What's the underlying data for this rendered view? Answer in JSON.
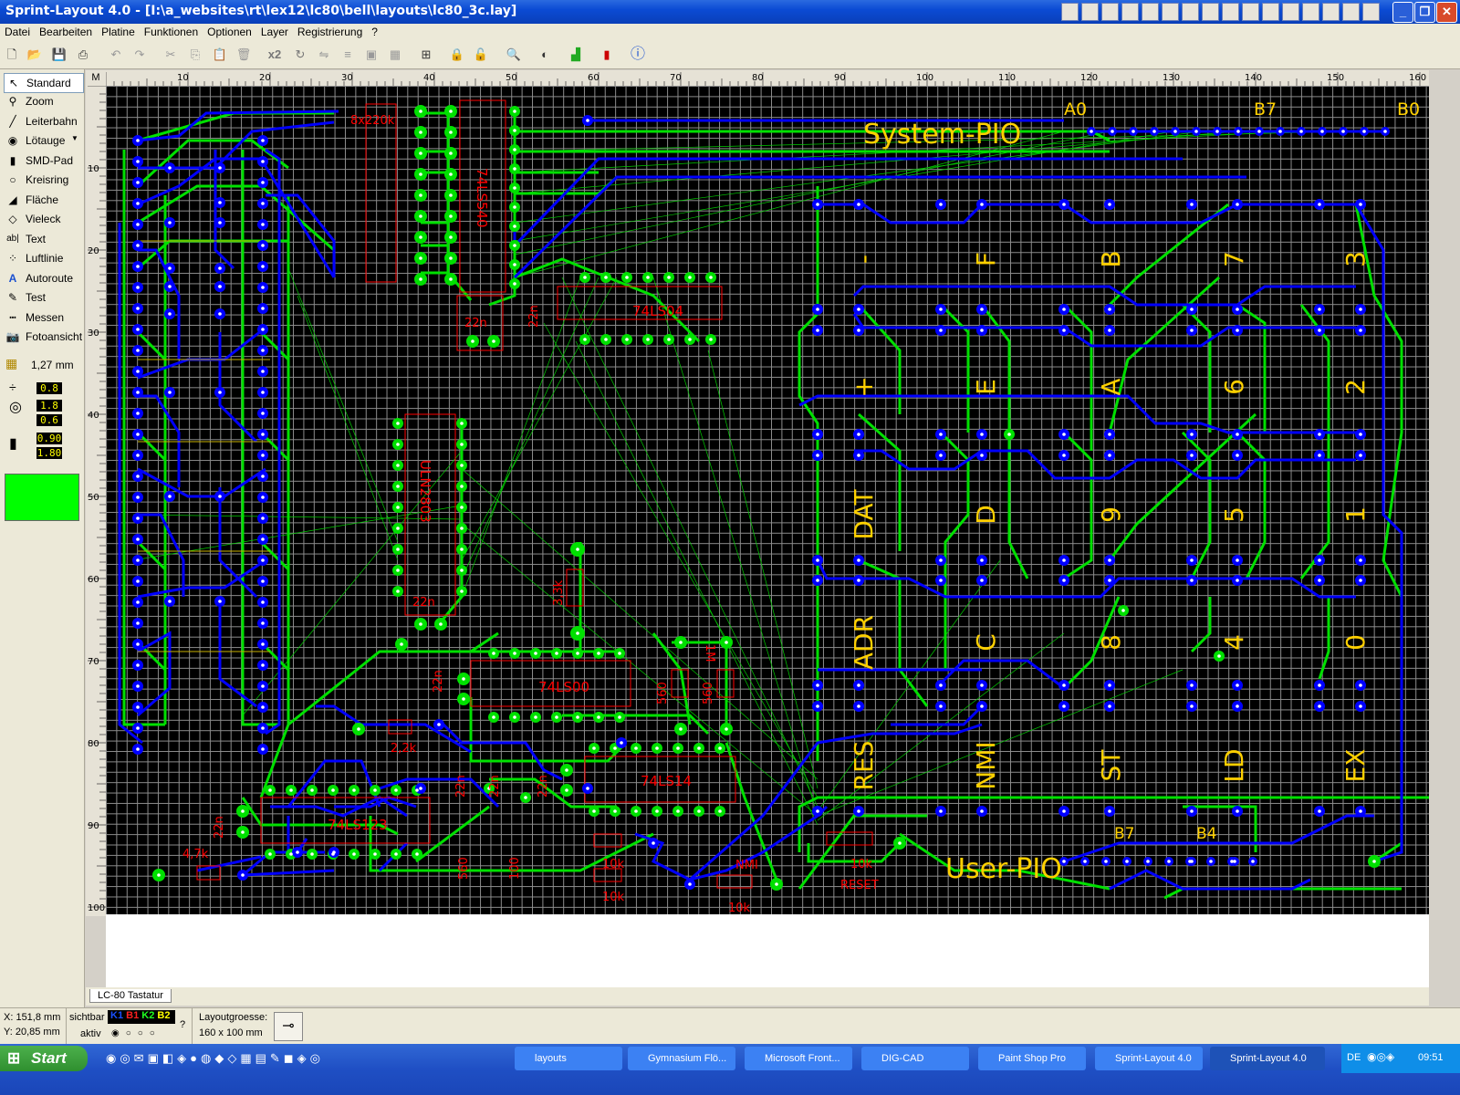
{
  "window": {
    "title": "Sprint-Layout 4.0 - [I:\\a_websites\\rt\\lex12\\lc80\\bell\\layouts\\lc80_3c.lay]"
  },
  "menu": [
    "Datei",
    "Bearbeiten",
    "Platine",
    "Funktionen",
    "Optionen",
    "Layer",
    "Registrierung",
    "?"
  ],
  "toolbar": {
    "mirror_label": "x2"
  },
  "tools": [
    {
      "label": "Standard",
      "icon": "arrow-icon"
    },
    {
      "label": "Zoom",
      "icon": "magnifier-icon"
    },
    {
      "label": "Leiterbahn",
      "icon": "track-icon"
    },
    {
      "label": "Lötauge",
      "icon": "pad-icon"
    },
    {
      "label": "SMD-Pad",
      "icon": "smd-icon"
    },
    {
      "label": "Kreisring",
      "icon": "ring-icon"
    },
    {
      "label": "Fläche",
      "icon": "area-icon"
    },
    {
      "label": "Vieleck",
      "icon": "polygon-icon"
    },
    {
      "label": "Text",
      "icon": "text-icon"
    },
    {
      "label": "Luftlinie",
      "icon": "airwire-icon"
    },
    {
      "label": "Autoroute",
      "icon": "autoroute-icon"
    },
    {
      "label": "Test",
      "icon": "test-icon"
    },
    {
      "label": "Messen",
      "icon": "measure-icon"
    },
    {
      "label": "Fotoansicht",
      "icon": "camera-icon"
    }
  ],
  "settings": {
    "grid": "1,27 mm",
    "v1": "0.8",
    "v2": "1.8",
    "v3": "0.6",
    "v4": "0.90",
    "v5": "1.80"
  },
  "ruler": {
    "corner": "M",
    "top_labels": [
      "10",
      "20",
      "30",
      "40",
      "50",
      "60",
      "70",
      "80",
      "90",
      "100",
      "110",
      "120",
      "130",
      "140",
      "150",
      "160"
    ],
    "left_labels": [
      "10",
      "20",
      "30",
      "40",
      "50",
      "60",
      "70",
      "80",
      "90",
      "100"
    ]
  },
  "board_labels": {
    "system_pio": "System-PIO",
    "user_pio": "User-PIO",
    "a0": "A0",
    "b7_top": "B7",
    "b0": "B0",
    "b7_bottom": "B7",
    "b4": "B4",
    "keys_row1": [
      "-",
      "F",
      "B",
      "7",
      "3"
    ],
    "keys_row2": [
      "+",
      "E",
      "A",
      "6",
      "2"
    ],
    "keys_row3": [
      "DAT",
      "D",
      "9",
      "5",
      "1"
    ],
    "keys_row4": [
      "ADR",
      "C",
      "8",
      "4",
      "0"
    ],
    "keys_row5": [
      "RES",
      "NMI",
      "ST",
      "LD",
      "EX"
    ]
  },
  "component_labels": {
    "rnet": "8x220k",
    "ic1": "74LS540",
    "ic2": "74LS04",
    "ic3": "ULN2803",
    "ic4": "74LS00",
    "ic5": "74LS14",
    "ic6": "74LS123",
    "c1": "22n",
    "c2": "22n",
    "c3": "22n",
    "c4": "22n",
    "c5": "22n",
    "c6": "22n",
    "c7": "22n",
    "c8": "22n",
    "r1": "3,3k",
    "r2": "2,2k",
    "r3": "4,7k",
    "r4": "1M",
    "r5": "560",
    "r6": "560",
    "r7": "10k",
    "r8": "10k",
    "r9": "10k",
    "r10": "10k",
    "r11": "560",
    "r12": "100",
    "nmi": "NMI",
    "reset_val": "10k",
    "reset": "RESET"
  },
  "layer_tab": "LC-80 Tastatur",
  "status": {
    "x": "X: 151,8 mm",
    "y": "Y: 20,85 mm",
    "sichtbar": "sichtbar",
    "aktiv": "aktiv",
    "layers": [
      "K1",
      "B1",
      "K2",
      "B2"
    ],
    "layout_size_label": "Layoutgroesse:",
    "layout_size": "160 x 100 mm",
    "help": "?"
  },
  "taskbar": {
    "start": "Start",
    "tasks": [
      "layouts",
      "Gymnasium Flö...",
      "Microsoft Front...",
      "DIG-CAD",
      "Paint Shop Pro",
      "Sprint-Layout 4.0",
      "Sprint-Layout 4.0"
    ],
    "lang": "DE",
    "clock": "09:51"
  },
  "colors": {
    "track_top": "#00ff00",
    "track_bottom": "#0000ff",
    "labels": "#ffff00",
    "silkscreen": "#ff0000"
  }
}
